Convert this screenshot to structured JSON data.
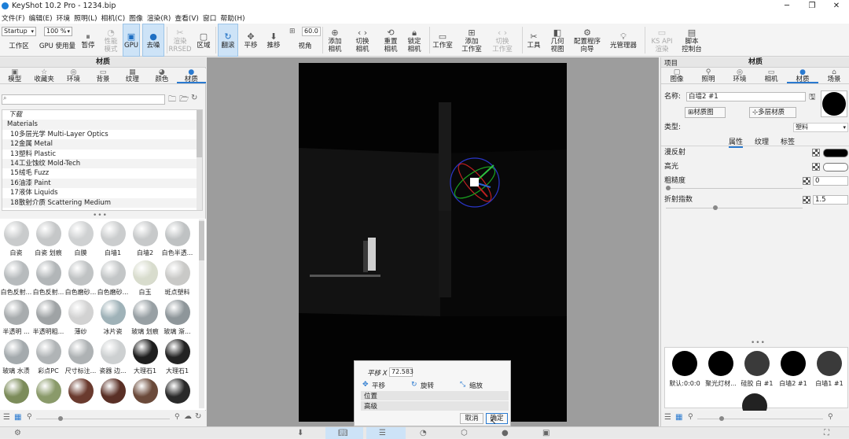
{
  "window": {
    "title": "KeyShot 10.2 Pro  -  1234.bip",
    "min": "─",
    "restore": "❐",
    "close": "✕"
  },
  "menu": [
    "文件(F)",
    "编辑(E)",
    "环境",
    "照明(L)",
    "相机(C)",
    "图像",
    "渲染(R)",
    "查看(V)",
    "窗口",
    "帮助(H)"
  ],
  "toolbar": {
    "workspace_value": "Startup",
    "zoom_value": "100 %",
    "fov_value": "60.0",
    "workspace": "工作区",
    "gpu_usage": "GPU 使用量",
    "pause": "暂停",
    "perf_mode": "性能\n模式",
    "gpu": "GPU",
    "denoise": "去噪",
    "render_region": "渲染\nRRSED",
    "region": "区域",
    "tumble": "翻滚",
    "pan": "平移",
    "dolly": "推移",
    "fov": "视角",
    "add_camera": "添加\n相机",
    "switch_camera": "切换\n相机",
    "reset_camera": "重置\n相机",
    "lock_camera": "锁定\n相机",
    "studio": "工作室",
    "add_studio": "添加\n工作室",
    "switch_studio": "切换\n工作室",
    "tools": "工具",
    "geometry_view": "几何\n视图",
    "config_wizard": "配置程序\n向导",
    "light_manager": "光管理器",
    "kspy": "KS API\n渲染",
    "script_console": "脚本\n控制台"
  },
  "left_panel": {
    "title": "材质",
    "tabs": [
      "模型",
      "收藏夹",
      "环境",
      "背景",
      "纹理",
      "颜色",
      "材质"
    ],
    "search_placeholder": "",
    "tree": [
      "下载",
      "Materials",
      "10多层光学 Multi-Layer Optics",
      "12金属 Metal",
      "13塑料 Plastic",
      "14工业蚀纹 Mold-Tech",
      "15绒毛 Fuzz",
      "16油漆 Paint",
      "17液体 Liquids",
      "18散射介质 Scattering Medium"
    ],
    "swatches": [
      {
        "label": "白瓷",
        "color": "#c9cbcc"
      },
      {
        "label": "白瓷 划痕",
        "color": "#c5c7c8"
      },
      {
        "label": "白膜",
        "color": "#cfd1d2"
      },
      {
        "label": "白墙1",
        "color": "#cbcdce"
      },
      {
        "label": "白墙2",
        "color": "#c7c9ca"
      },
      {
        "label": "白色半透...",
        "color": "#bfc2c3"
      },
      {
        "label": "白色反射...",
        "color": "#b7bbbd"
      },
      {
        "label": "白色反射...",
        "color": "#b2b6b8"
      },
      {
        "label": "白色磨砂...",
        "color": "#c0c3c4"
      },
      {
        "label": "白色磨砂...",
        "color": "#c3c6c7"
      },
      {
        "label": "白玉",
        "color": "#d8dccd"
      },
      {
        "label": "斑点塑料",
        "color": "#c9c9c7"
      },
      {
        "label": "半透明 ...",
        "color": "#a8acae"
      },
      {
        "label": "半透明粗...",
        "color": "#9fa3a5"
      },
      {
        "label": "薄纱",
        "color": "#d2d2d2"
      },
      {
        "label": "冰片瓷",
        "color": "#9fb2b8"
      },
      {
        "label": "玻璃 划痕",
        "color": "#98a0a4"
      },
      {
        "label": "玻璃 渐...",
        "color": "#8e969a"
      },
      {
        "label": "玻璃 水渍",
        "color": "#a4aaad"
      },
      {
        "label": "彩点PC",
        "color": "#b0b4b6"
      },
      {
        "label": "尺寸标注...",
        "color": "#aeb2b4"
      },
      {
        "label": "瓷器 边...",
        "color": "#cdd0d1"
      },
      {
        "label": "大理石1",
        "color": "#1e1e1e"
      },
      {
        "label": "大理石1",
        "color": "#232323"
      },
      {
        "label": "",
        "color": "#7c8c5a"
      },
      {
        "label": "",
        "color": "#8a9a6a"
      },
      {
        "label": "",
        "color": "#6a3a2e"
      },
      {
        "label": "",
        "color": "#5a3026"
      },
      {
        "label": "",
        "color": "#6b4a3a"
      },
      {
        "label": "",
        "color": "#2a2a2a"
      }
    ]
  },
  "dialog": {
    "field_label": "平移 X",
    "field_value": "72.583",
    "tab_move": "平移",
    "tab_rotate": "旋转",
    "tab_scale": "缩放",
    "section_position": "位置",
    "section_advanced": "高级",
    "cancel": "取消",
    "ok": "确定"
  },
  "right_panel": {
    "header_left": "项目",
    "title": "材质",
    "tabs": [
      "图像",
      "照明",
      "环境",
      "相机",
      "材质",
      "场景"
    ],
    "name_label": "名称:",
    "name_value": "白墙2 #1",
    "material_graph": "材质图",
    "multi_layer": "多层材质",
    "type_label": "类型:",
    "type_value": "塑料",
    "subtabs": [
      "属性",
      "纹理",
      "标签"
    ],
    "diffuse": "漫反射",
    "specular": "高光",
    "roughness": "粗糙度",
    "roughness_value": "0",
    "ior": "折射指数",
    "ior_value": "1.5",
    "diffuse_color": "#000000",
    "specular_color": "#ffffff",
    "scene_materials": [
      {
        "label": "默认:0:0:0",
        "color": "#000000"
      },
      {
        "label": "聚光灯材...",
        "color": "#000000"
      },
      {
        "label": "硅胶 白 #1",
        "color": "#3a3a3a"
      },
      {
        "label": "白墙2 #1",
        "color": "#000000"
      },
      {
        "label": "白墙1 #1",
        "color": "#3a3a3a"
      }
    ]
  }
}
